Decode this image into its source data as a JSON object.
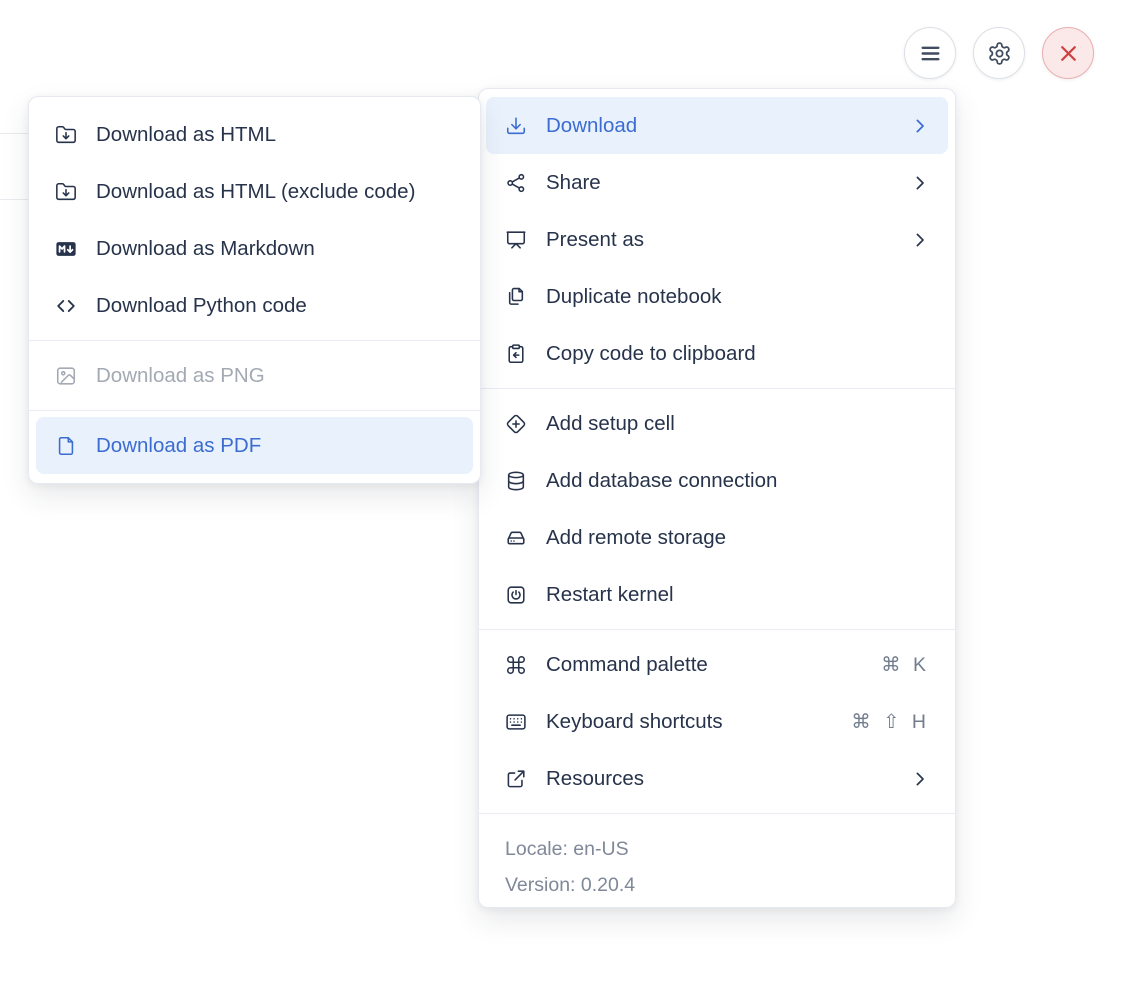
{
  "colors": {
    "accent_blue": "#3b6cd0",
    "highlight_bg": "#e9f1fc",
    "text_dark": "#27334b",
    "muted_gray": "#7f8899",
    "disabled_gray": "#a3aab4",
    "danger_red": "#cf4040"
  },
  "toolbar": {
    "buttons": [
      {
        "name": "notebook-actions",
        "icon": "hamburger-icon"
      },
      {
        "name": "settings",
        "icon": "gear-icon"
      },
      {
        "name": "close",
        "icon": "x-icon",
        "danger": true
      }
    ]
  },
  "download_submenu": {
    "items": [
      {
        "label": "Download as HTML",
        "icon": "folder-down-icon"
      },
      {
        "label": "Download as HTML (exclude code)",
        "icon": "folder-down-icon"
      },
      {
        "label": "Download as Markdown",
        "icon": "markdown-download-icon"
      },
      {
        "label": "Download Python code",
        "icon": "code-icon"
      },
      {
        "type": "separator"
      },
      {
        "label": "Download as PNG",
        "icon": "image-icon",
        "disabled": true
      },
      {
        "type": "separator"
      },
      {
        "label": "Download as PDF",
        "icon": "file-icon",
        "highlighted": true
      }
    ]
  },
  "main_menu": {
    "items": [
      {
        "label": "Download",
        "icon": "download-icon",
        "submenu": true,
        "highlighted": true
      },
      {
        "label": "Share",
        "icon": "share-icon",
        "submenu": true
      },
      {
        "label": "Present as",
        "icon": "presentation-icon",
        "submenu": true
      },
      {
        "label": "Duplicate notebook",
        "icon": "copy-icon"
      },
      {
        "label": "Copy code to clipboard",
        "icon": "clipboard-copy-icon"
      },
      {
        "type": "separator"
      },
      {
        "label": "Add setup cell",
        "icon": "diamond-plus-icon"
      },
      {
        "label": "Add database connection",
        "icon": "database-icon"
      },
      {
        "label": "Add remote storage",
        "icon": "hard-drive-icon"
      },
      {
        "label": "Restart kernel",
        "icon": "power-square-icon"
      },
      {
        "type": "separator"
      },
      {
        "label": "Command palette",
        "icon": "command-icon",
        "shortcut": "⌘ K"
      },
      {
        "label": "Keyboard shortcuts",
        "icon": "keyboard-icon",
        "shortcut": "⌘ ⇧ H"
      },
      {
        "label": "Resources",
        "icon": "external-link-icon",
        "submenu": true
      },
      {
        "type": "separator"
      },
      {
        "type": "footer",
        "lines": [
          "Locale: en-US",
          "Version: 0.20.4"
        ]
      }
    ]
  }
}
